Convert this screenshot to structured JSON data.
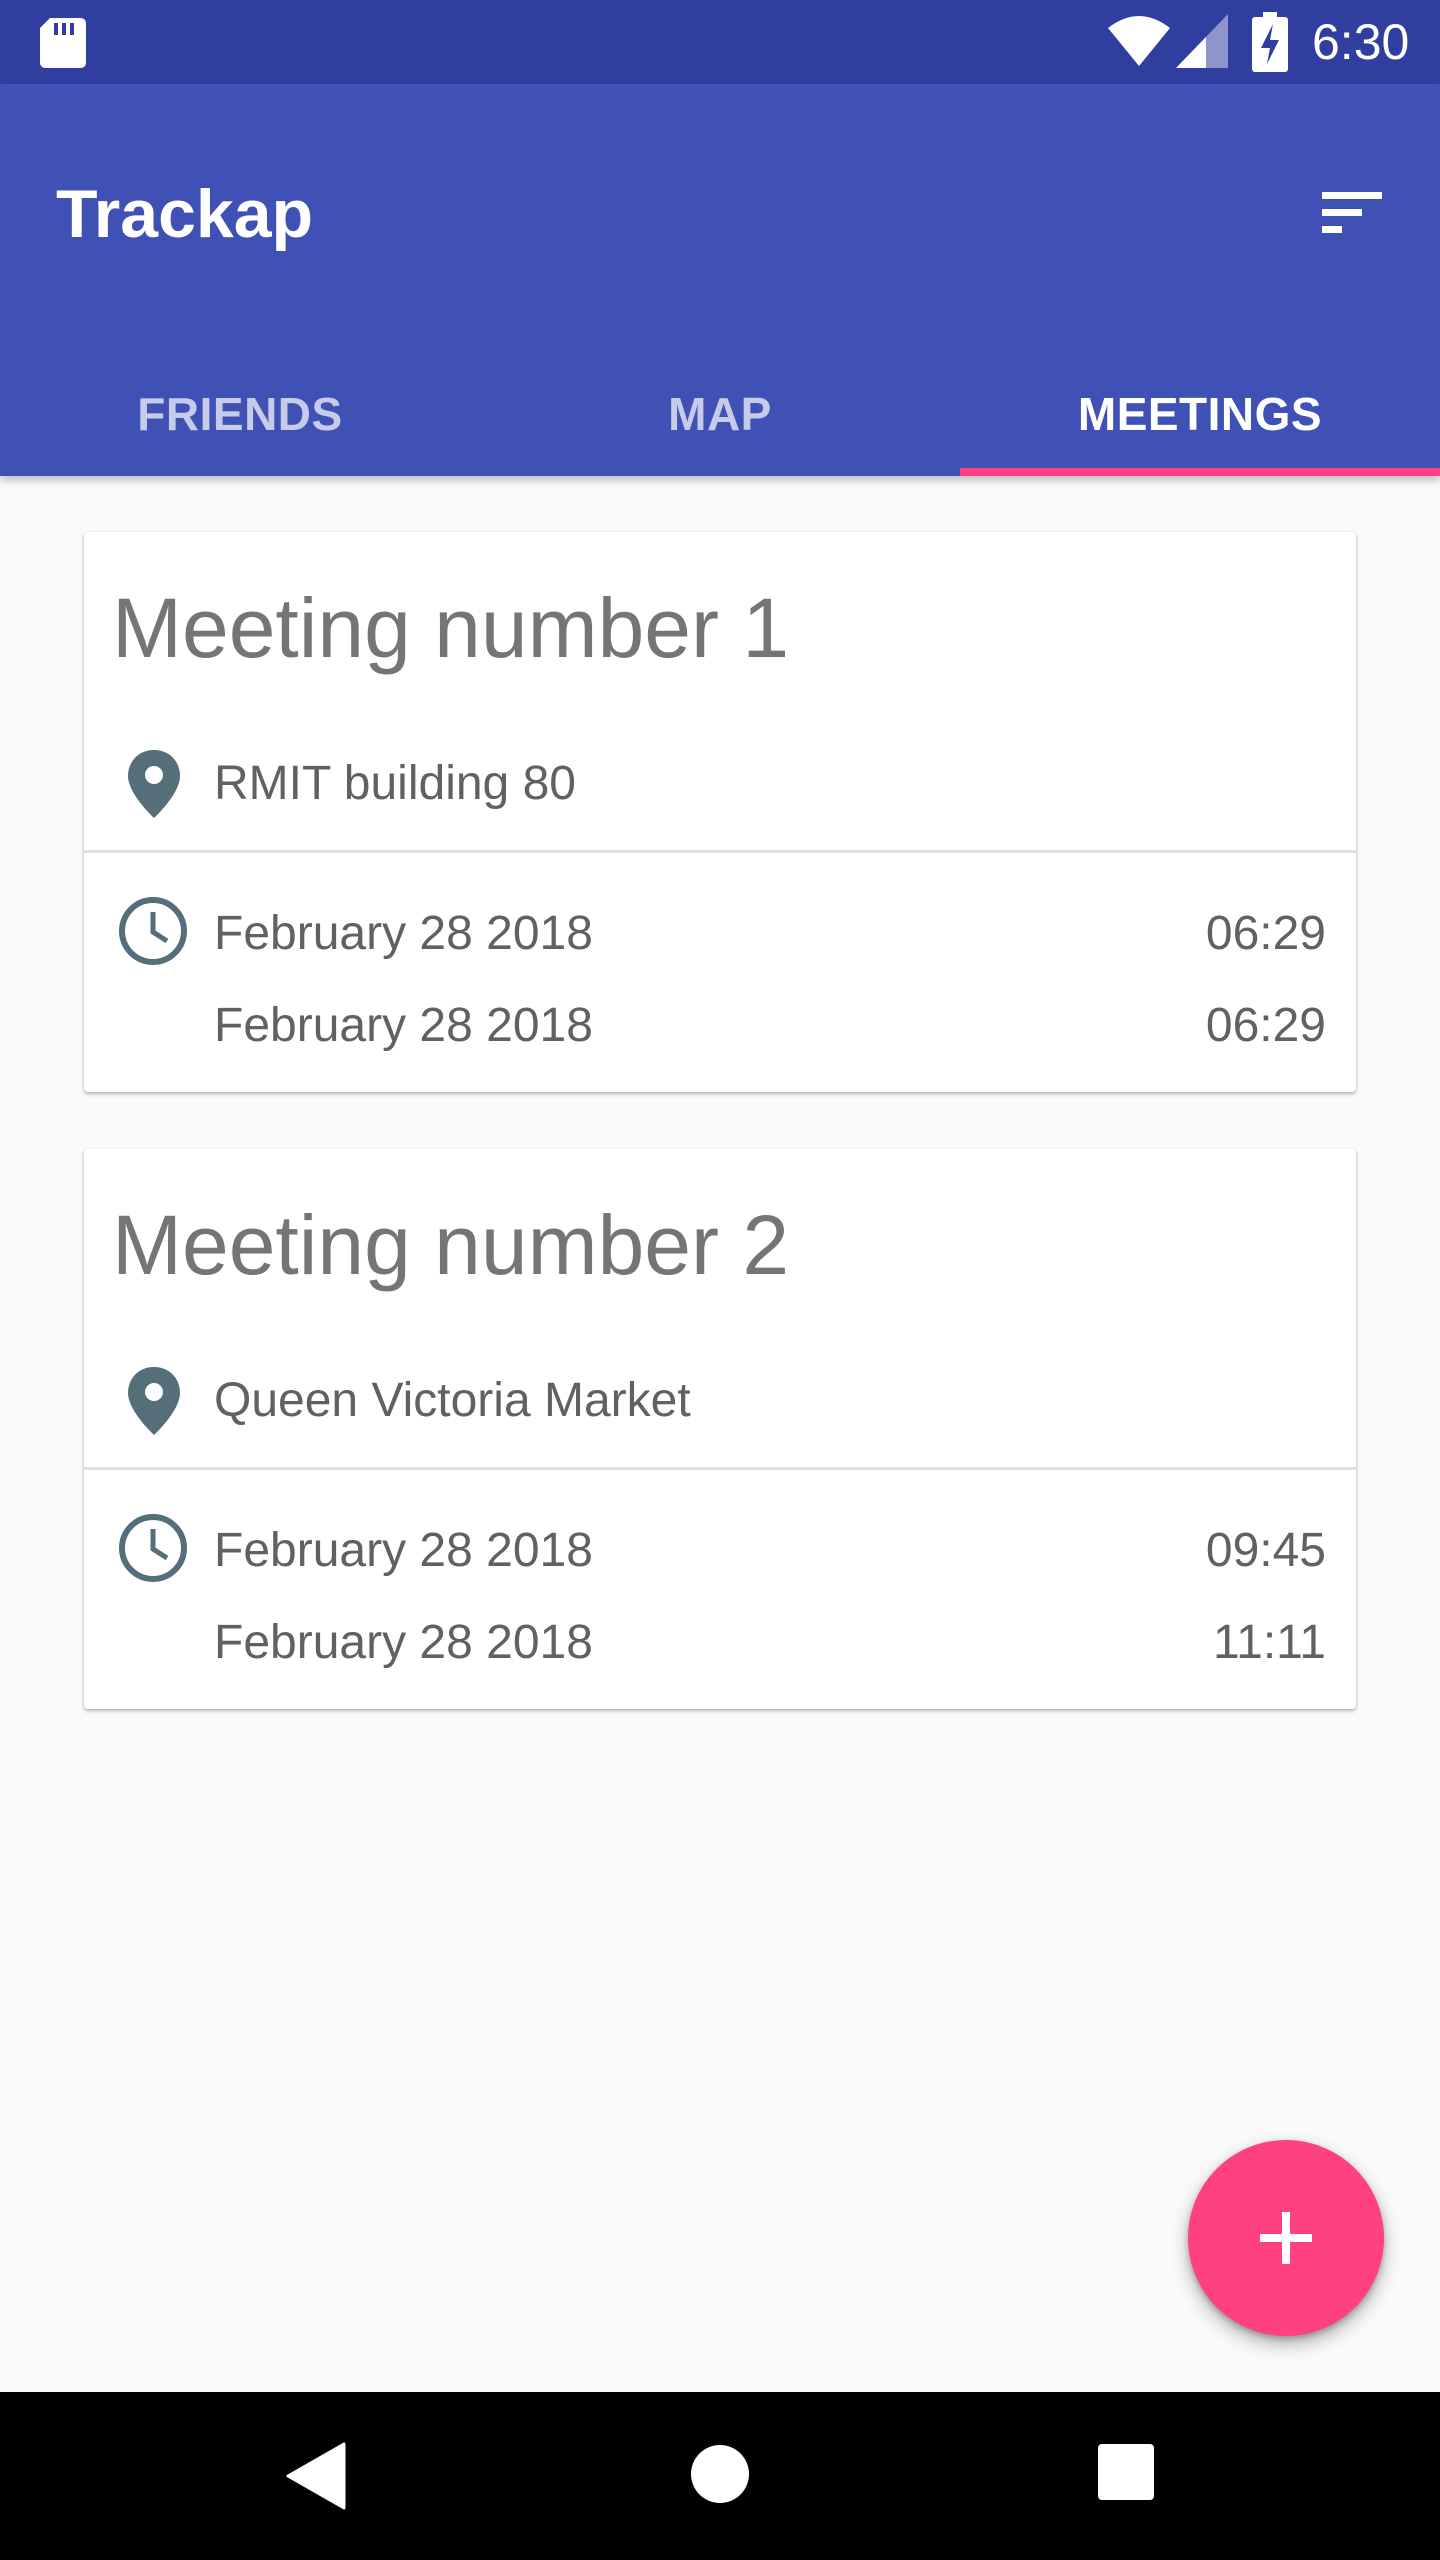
{
  "status_bar": {
    "time": "6:30",
    "icons": [
      "sd-card-icon",
      "wifi-icon",
      "signal-icon",
      "battery-charging-icon"
    ]
  },
  "app_bar": {
    "title": "Trackap",
    "sort_icon": "sort-icon"
  },
  "tabs": [
    {
      "label": "FRIENDS",
      "active": false
    },
    {
      "label": "MAP",
      "active": false
    },
    {
      "label": "MEETINGS",
      "active": true
    }
  ],
  "meetings": [
    {
      "title": "Meeting number 1",
      "location": "RMIT building 80",
      "start_date": "February 28 2018",
      "start_time": "06:29",
      "end_date": "February 28 2018",
      "end_time": "06:29"
    },
    {
      "title": "Meeting number 2",
      "location": "Queen Victoria Market",
      "start_date": "February 28 2018",
      "start_time": "09:45",
      "end_date": "February 28 2018",
      "end_time": "11:11"
    }
  ],
  "fab": {
    "icon": "plus-icon"
  },
  "nav_bar": {
    "icons": [
      "back-icon",
      "home-icon",
      "recents-icon"
    ]
  },
  "colors": {
    "primary": "#3f51b5",
    "primary_dark": "#303f9f",
    "accent": "#ff4081",
    "icon_grey": "#546e7a"
  }
}
